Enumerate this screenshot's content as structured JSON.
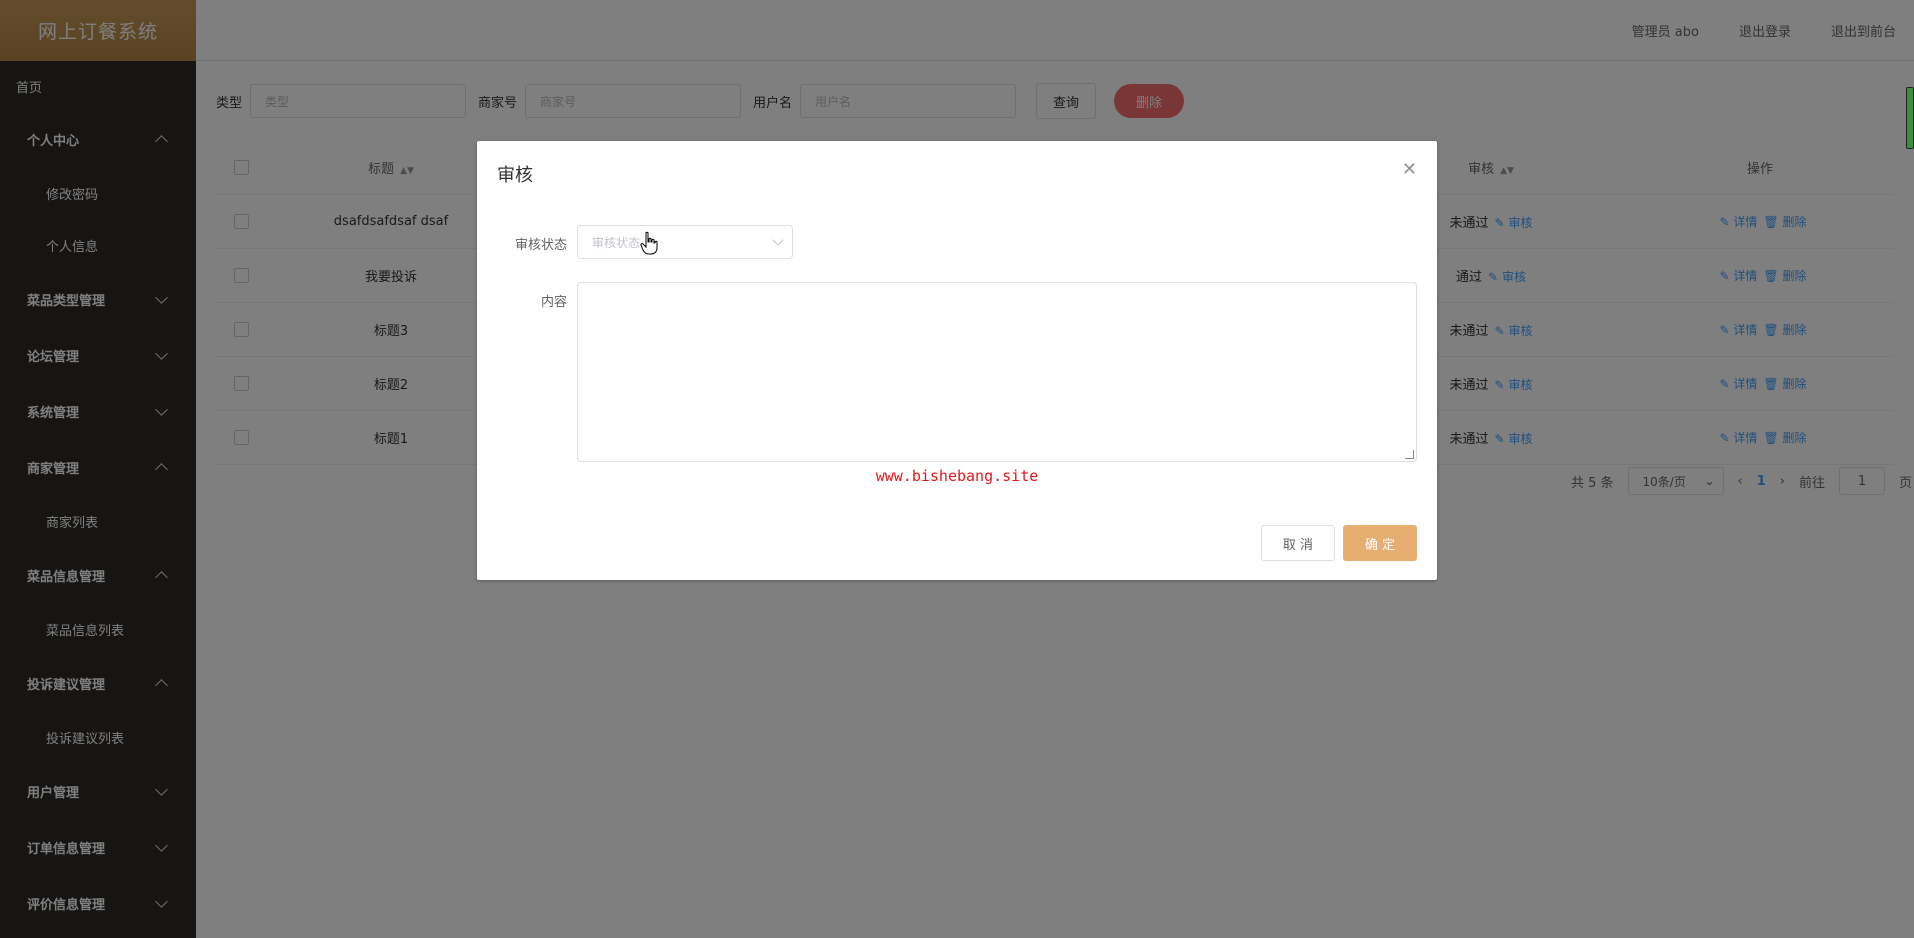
{
  "app": {
    "title": "网上订餐系统"
  },
  "header": {
    "user": "管理员 abo",
    "logout": "退出登录",
    "home": "退出到前台"
  },
  "sidebar": {
    "home": "首页",
    "groups": [
      {
        "label": "个人中心",
        "expanded": true,
        "items": [
          "修改密码",
          "个人信息"
        ]
      },
      {
        "label": "菜品类型管理",
        "expanded": false,
        "items": []
      },
      {
        "label": "论坛管理",
        "expanded": false,
        "items": []
      },
      {
        "label": "系统管理",
        "expanded": false,
        "items": []
      },
      {
        "label": "商家管理",
        "expanded": true,
        "items": [
          "商家列表"
        ]
      },
      {
        "label": "菜品信息管理",
        "expanded": true,
        "items": [
          "菜品信息列表"
        ]
      },
      {
        "label": "投诉建议管理",
        "expanded": true,
        "items": [
          "投诉建议列表"
        ]
      },
      {
        "label": "用户管理",
        "expanded": false,
        "items": []
      },
      {
        "label": "订单信息管理",
        "expanded": false,
        "items": []
      },
      {
        "label": "评价信息管理",
        "expanded": false,
        "items": []
      }
    ]
  },
  "filters": {
    "type_label": "类型",
    "type_placeholder": "类型",
    "merchant_label": "商家号",
    "merchant_placeholder": "商家号",
    "user_label": "用户名",
    "user_placeholder": "用户名",
    "query": "查询",
    "delete": "删除"
  },
  "table": {
    "headers": {
      "title": "标题",
      "review": "审核",
      "actions": "操作"
    },
    "rows": [
      {
        "title": "dsafdsafdsaf dsaf",
        "status": "未通过"
      },
      {
        "title": "我要投诉",
        "status": "通过"
      },
      {
        "title": "标题3",
        "status": "未通过"
      },
      {
        "title": "标题2",
        "status": "未通过"
      },
      {
        "title": "标题1",
        "status": "未通过"
      }
    ],
    "review_link": "审核",
    "detail_link": "详情",
    "delete_link": "删除"
  },
  "pagination": {
    "total": "共 5 条",
    "page_size": "10条/页",
    "current": "1",
    "goto_label": "前往",
    "goto_value": "1",
    "page_unit": "页"
  },
  "dialog": {
    "title": "审核",
    "status_label": "审核状态",
    "status_placeholder": "审核状态",
    "content_label": "内容",
    "watermark": "www.bishebang.site",
    "cancel": "取 消",
    "confirm": "确 定"
  }
}
